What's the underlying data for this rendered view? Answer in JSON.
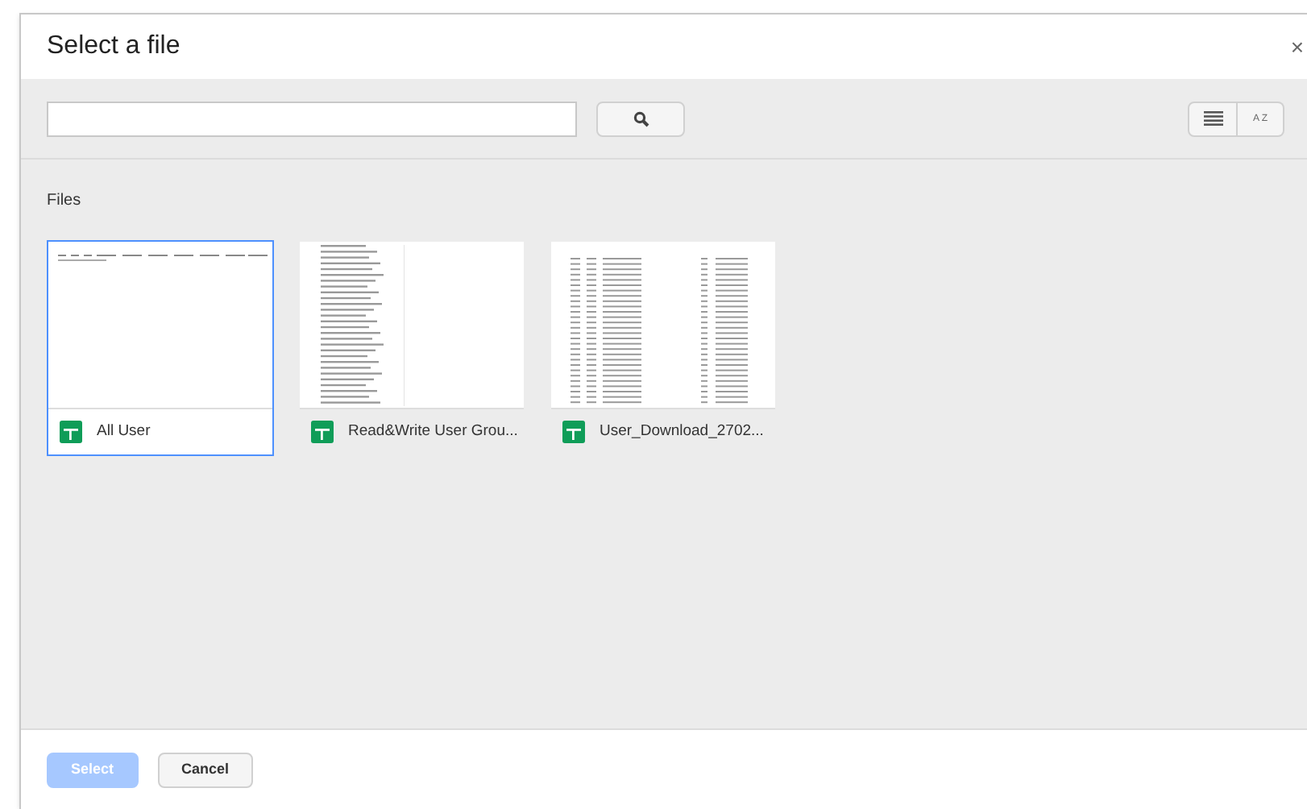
{
  "dialog": {
    "title": "Select a file",
    "close": "×"
  },
  "toolbar": {
    "sort_label": "A Z"
  },
  "section": {
    "title": "Files"
  },
  "files": [
    {
      "name": "All User",
      "selected": true,
      "kind": "wide"
    },
    {
      "name": "Read&Write User Grou...",
      "selected": false,
      "kind": "list"
    },
    {
      "name": "User_Download_2702...",
      "selected": false,
      "kind": "table"
    }
  ],
  "buttons": [
    {
      "label": "Select",
      "disabled": true,
      "kind": "primary"
    },
    {
      "label": "Cancel",
      "disabled": false,
      "kind": "secondary"
    }
  ]
}
